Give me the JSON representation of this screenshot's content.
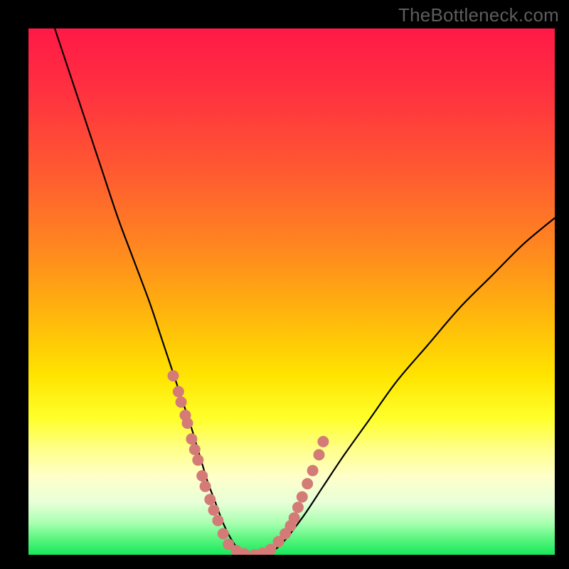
{
  "watermark": "TheBottleneck.com",
  "chart_data": {
    "type": "line",
    "title": "",
    "xlabel": "",
    "ylabel": "",
    "xlim": [
      0,
      100
    ],
    "ylim": [
      0,
      100
    ],
    "axes_visible": false,
    "grid": false,
    "legend": false,
    "gradient_stops": [
      {
        "offset": 0,
        "color": "#ff1947"
      },
      {
        "offset": 12,
        "color": "#ff3140"
      },
      {
        "offset": 28,
        "color": "#ff5c30"
      },
      {
        "offset": 42,
        "color": "#ff881f"
      },
      {
        "offset": 55,
        "color": "#ffb80c"
      },
      {
        "offset": 66,
        "color": "#ffe400"
      },
      {
        "offset": 74,
        "color": "#ffff2a"
      },
      {
        "offset": 80,
        "color": "#ffff8a"
      },
      {
        "offset": 85,
        "color": "#ffffc8"
      },
      {
        "offset": 90,
        "color": "#e8ffd8"
      },
      {
        "offset": 94,
        "color": "#a8ffb0"
      },
      {
        "offset": 97,
        "color": "#58f57e"
      },
      {
        "offset": 100,
        "color": "#18e85a"
      }
    ],
    "series": [
      {
        "name": "bottleneck-curve",
        "stroke": "#000000",
        "stroke_width": 2.2,
        "x": [
          5,
          8,
          11,
          14,
          17,
          20,
          23,
          25,
          27,
          29,
          31,
          32.5,
          34,
          35.5,
          37,
          38.5,
          40,
          42,
          45,
          48,
          52,
          56,
          60,
          65,
          70,
          76,
          82,
          88,
          94,
          100
        ],
        "y": [
          100,
          91,
          82,
          73,
          64,
          56,
          48,
          42,
          36,
          30,
          24,
          19,
          14,
          10,
          6,
          3,
          1,
          0,
          0,
          2,
          7,
          13,
          19,
          26,
          33,
          40,
          47,
          53,
          59,
          64
        ]
      },
      {
        "name": "sample-dots",
        "type": "scatter",
        "marker": "circle",
        "marker_size": 8,
        "fill": "#d47b78",
        "stroke": "none",
        "x": [
          27.5,
          28.5,
          29.0,
          29.8,
          30.2,
          31.0,
          31.6,
          32.2,
          33.0,
          33.6,
          34.5,
          35.2,
          36.0,
          37.0,
          38.0,
          39.5,
          41.0,
          43.0,
          44.5,
          46.0,
          47.5,
          48.8,
          49.8,
          50.5,
          51.2,
          52.0,
          53.0,
          54.0,
          55.2,
          56.0
        ],
        "y": [
          34.0,
          31.0,
          29.0,
          26.5,
          25.0,
          22.0,
          20.0,
          18.0,
          15.0,
          13.0,
          10.5,
          8.5,
          6.5,
          4.0,
          2.0,
          0.8,
          0.2,
          0.0,
          0.3,
          1.0,
          2.5,
          4.0,
          5.5,
          7.0,
          9.0,
          11.0,
          13.5,
          16.0,
          19.0,
          21.5
        ]
      }
    ]
  }
}
